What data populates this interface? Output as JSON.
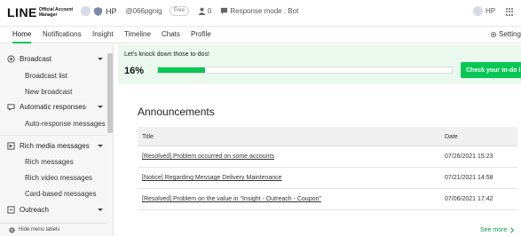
{
  "header": {
    "logo_main": "LINE",
    "logo_sub": "Official Account Manager",
    "account_name": "HP",
    "account_id": "@066pgnig",
    "plan_badge": "Free",
    "friends_count": "0",
    "response_mode": "Response mode : Bot",
    "user_name": "HP"
  },
  "tabs": [
    {
      "label": "Home",
      "active": true
    },
    {
      "label": "Notifications"
    },
    {
      "label": "Insight"
    },
    {
      "label": "Timeline"
    },
    {
      "label": "Chats"
    },
    {
      "label": "Profile"
    }
  ],
  "settings_label": "Settings",
  "sidebar": {
    "groups": [
      {
        "label": "Broadcast",
        "icon": "broadcast-icon",
        "items": [
          "Broadcast list",
          "New broadcast"
        ]
      },
      {
        "label": "Automatic responses",
        "icon": "auto-response-icon",
        "items": [
          "Auto-response messages"
        ]
      },
      {
        "label": "Rich media messages",
        "icon": "rich-media-icon",
        "items": [
          "Rich messages",
          "Rich video messages",
          "Card-based messages"
        ]
      },
      {
        "label": "Outreach",
        "icon": "outreach-icon",
        "items": []
      }
    ],
    "hide_labels": "Hide menu labels"
  },
  "todo": {
    "title": "Let's knock down those to-dos!",
    "percent": "16%",
    "progress_fraction": 0.16,
    "button": "Check your to-do list"
  },
  "announcements": {
    "title": "Announcements",
    "col_title": "Title",
    "col_date": "Date",
    "rows": [
      {
        "title": "[Resolved] Problem occurred on some accounts",
        "date": "07/26/2021 15:23"
      },
      {
        "title": "[Notice] Regarding Message Delivery Maintenance",
        "date": "07/21/2021 14:58"
      },
      {
        "title": "[Resolved] Problem on the value in \"Insight - Outreach - Coupon\"",
        "date": "07/06/2021 17:42"
      }
    ],
    "see_more": "See more"
  },
  "colors": {
    "accent": "#06c755"
  }
}
